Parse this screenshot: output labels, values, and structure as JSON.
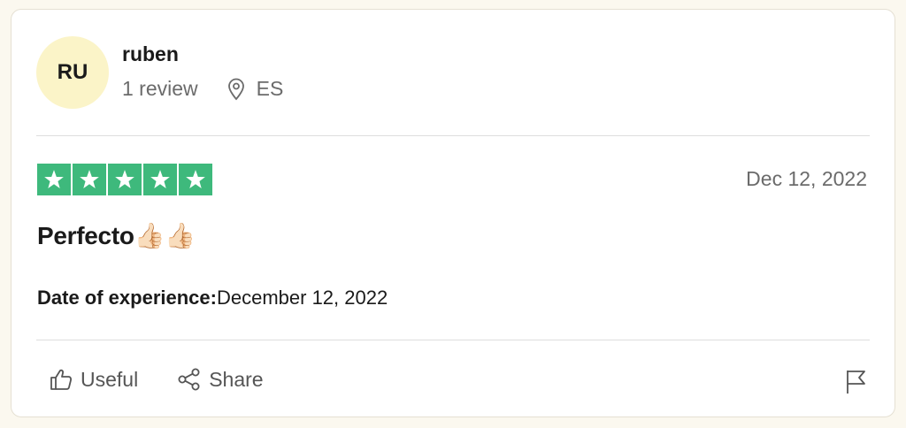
{
  "reviewer": {
    "initials": "RU",
    "name": "ruben",
    "review_count": "1 review",
    "country": "ES",
    "avatar_color": "#fbf4c8"
  },
  "review": {
    "rating": 5,
    "max_rating": 5,
    "star_color": "#3eb97c",
    "date": "Dec 12, 2022",
    "title": "Perfecto👍🏻👍🏻",
    "experience_label": "Date of experience:",
    "experience_date": "December 12, 2022"
  },
  "actions": {
    "useful_label": "Useful",
    "share_label": "Share",
    "useful_icon": "thumbs-up-icon",
    "share_icon": "share-icon",
    "report_icon": "flag-icon",
    "location_icon": "location-pin-icon"
  }
}
